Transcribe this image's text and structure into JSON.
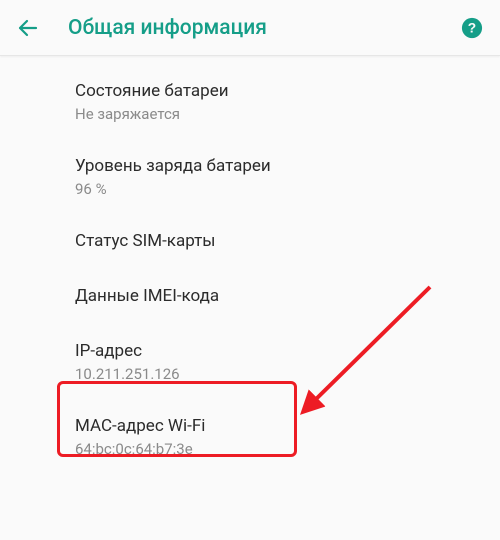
{
  "header": {
    "title": "Общая информация"
  },
  "items": [
    {
      "title": "Состояние батареи",
      "sub": "Не заряжается"
    },
    {
      "title": "Уровень заряда батареи",
      "sub": "96 %"
    },
    {
      "title": "Статус SIM-карты",
      "sub": ""
    },
    {
      "title": "Данные IMEI-кода",
      "sub": ""
    },
    {
      "title": "IP-адрес",
      "sub": "10.211.251.126"
    },
    {
      "title": "MAC-адрес Wi-Fi",
      "sub": "64:bc:0c:64:b7:3e"
    }
  ],
  "annotation": {
    "highlighted_item_index": 4,
    "arrow_color": "#ed1c24"
  }
}
